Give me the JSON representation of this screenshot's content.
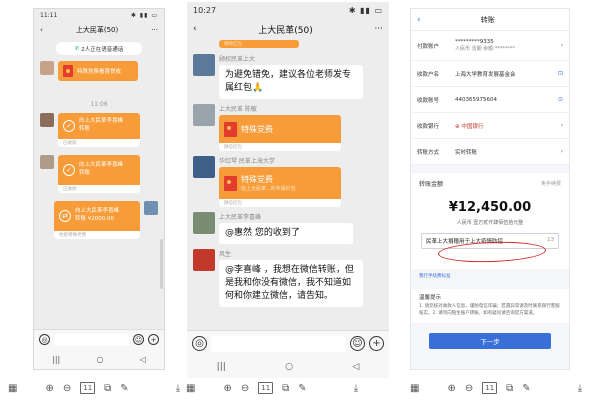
{
  "panel1": {
    "status_time": "11:11",
    "status_icons": "✱ ▮▮ ▭",
    "back": "‹",
    "title": "上大民革(50)",
    "more": "···",
    "call_pill": "2人正在语音通话",
    "call_icon": "phone-icon",
    "msg1": {
      "title": "特殊党费看喜悦收"
    },
    "time_caption": "11:06",
    "msg2": {
      "line1": "向上大民革李喜峰",
      "line2": "转账",
      "footer": "已收款"
    },
    "msg3": {
      "line1": "向上大民革李喜峰",
      "line2": "转账",
      "footer": "已收款"
    },
    "msg4": {
      "line1": "向上大民革李喜峰",
      "line2": "转账 ¥2000.00",
      "footer": "抗疫特殊党费"
    },
    "nav": [
      "|||",
      "○",
      "◁"
    ],
    "input_left": "◎",
    "input_emoji": "☺",
    "input_plus": "+"
  },
  "panel2": {
    "status_time": "10:27",
    "status_icons": "✱ ▮▮ ▭",
    "back": "‹",
    "title": "上大民革(50)",
    "more": "···",
    "top_faded": "继续红包",
    "m1": {
      "sender": "顾权民革上大",
      "text": "为避免错免，建议各位老师发专属红包🙏"
    },
    "m2": {
      "sender": "上大民革 陈敏",
      "title": "特殊党费",
      "footer": "微信红包"
    },
    "m3": {
      "sender": "华红琴 民革上海大学",
      "title": "特殊党费",
      "sub": "给上大民革...的专属红包",
      "footer": "微信红包"
    },
    "m4": {
      "sender": "上大民革李喜峰",
      "text": "@惠然 您的收到了"
    },
    "m5": {
      "sender": "风生",
      "text": "@李喜峰 ，我想在微信转账，但是我和你没有微信，我不知道如何和你建立微信，请告知。"
    },
    "nav": [
      "|||",
      "○",
      "◁"
    ],
    "input_left": "◎",
    "input_emoji": "☺",
    "input_plus": "+"
  },
  "panel3": {
    "back": "‹",
    "title": "转账",
    "fields": [
      {
        "label": "付款账户",
        "value": "*********9335",
        "sub": "人民币  活期  余额:********",
        "icon": "›"
      },
      {
        "label": "收款户名",
        "value": "上海大学教育发展基金会",
        "sub": "",
        "icon": "⊡"
      },
      {
        "label": "收款账号",
        "value": "440365975604",
        "sub": "",
        "icon": "⊙"
      },
      {
        "label": "收款银行",
        "value": "⊕ 中国银行",
        "sub": "",
        "icon": "›"
      },
      {
        "label": "转账方式",
        "value": "实时转账",
        "sub": "",
        "icon": "›"
      }
    ],
    "amount_caption": "转账金额",
    "amount_right": "免手续费",
    "amount": "¥12,450.00",
    "amount_words": "人民币  壹万贰仟肆佰伍拾元整",
    "remark": "民革上大捐赠用于上大疫情防控",
    "remark_count": "13",
    "link": "我行手续费标准",
    "tips_title": "温馨提示",
    "tips": "1. 请您核对收款人信息，谨防电信诈骗；若遇异常请及时联系银行客服核实。2. 请勿向陌生账户转账，如有疑问请咨询官方渠道。",
    "next": "下一步"
  },
  "toolbar": {
    "zoom_in": "⊕",
    "zoom_out": "⊖",
    "fit": "11",
    "crop": "⧉",
    "edit": "✎",
    "download": "⤓"
  }
}
